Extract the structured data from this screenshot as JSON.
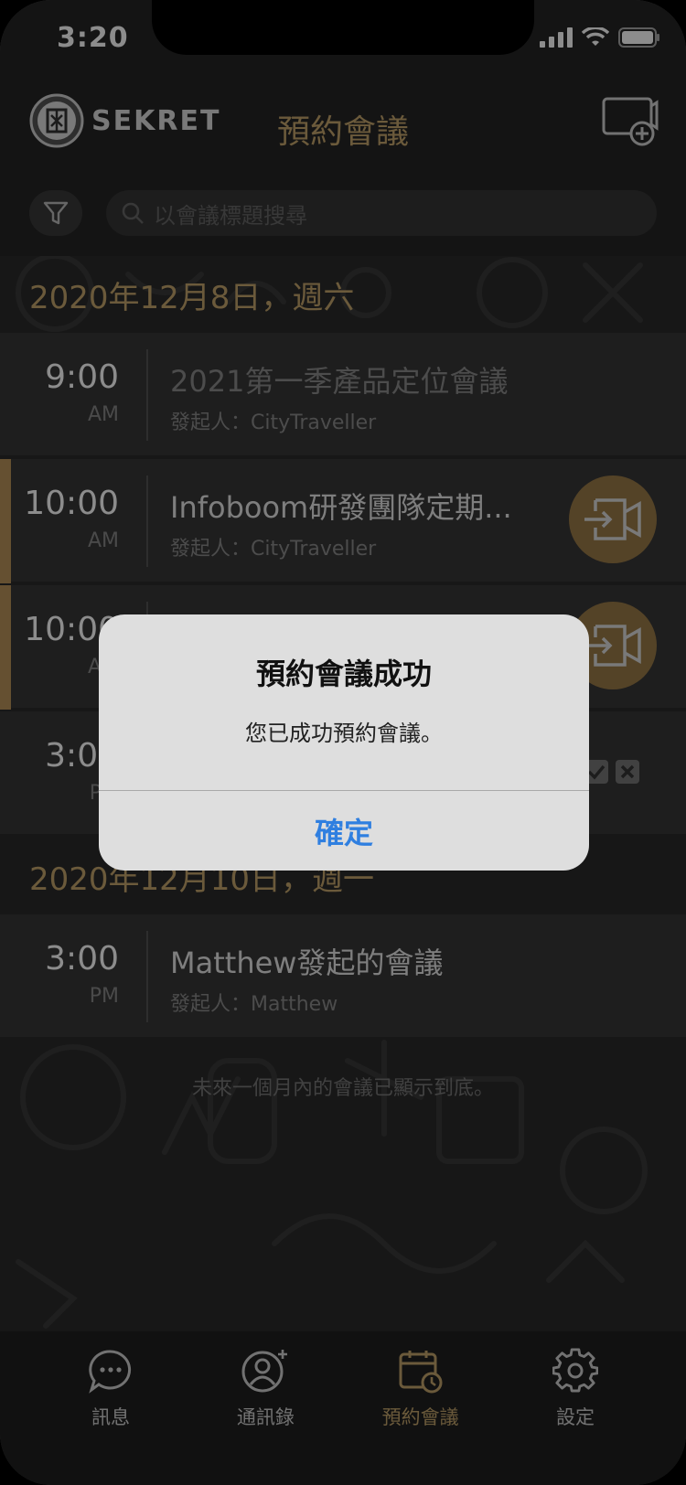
{
  "status_bar": {
    "time": "3:20"
  },
  "header": {
    "brand": "SEKRET",
    "title": "預約會議"
  },
  "search": {
    "placeholder": "以會議標題搜尋"
  },
  "sections": [
    {
      "date": "2020年12月8日，週六",
      "meetings": [
        {
          "time": "9:00",
          "ampm": "AM",
          "title": "2021第一季產品定位會議",
          "organizer": "發起人：CityTraveller"
        },
        {
          "time": "10:00",
          "ampm": "AM",
          "title": "Infoboom研發團隊定期...",
          "organizer": "發起人：CityTraveller"
        },
        {
          "time": "10:00",
          "ampm": "AM",
          "title": "",
          "organizer": ""
        },
        {
          "time": "3:00",
          "ampm": "PM",
          "title": "",
          "organizer": ""
        }
      ]
    },
    {
      "date": "2020年12月10日，週一",
      "meetings": [
        {
          "time": "3:00",
          "ampm": "PM",
          "title": "Matthew發起的會議",
          "organizer": "發起人：Matthew"
        }
      ]
    }
  ],
  "footer_note": "未來一個月內的會議已顯示到底。",
  "alert": {
    "title": "預約會議成功",
    "message": "您已成功預約會議。",
    "ok_label": "確定"
  },
  "tabs": [
    {
      "label": "訊息",
      "icon": "chat-bubble-icon"
    },
    {
      "label": "通訊錄",
      "icon": "add-contact-icon"
    },
    {
      "label": "預約會議",
      "icon": "calendar-clock-icon",
      "active": true
    },
    {
      "label": "設定",
      "icon": "gear-icon"
    }
  ],
  "colors": {
    "accent": "#c4a56c",
    "dialog_button": "#2f7fe0",
    "join_button": "#9a7a48"
  }
}
